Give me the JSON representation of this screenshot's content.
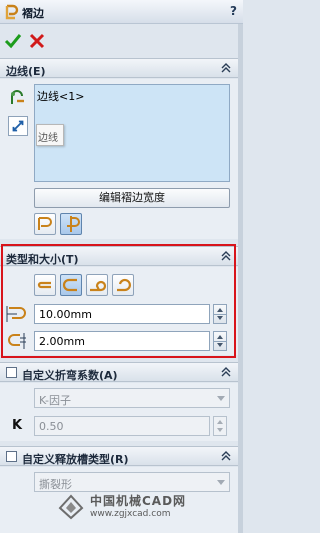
{
  "window": {
    "title": "褶边",
    "help": "?"
  },
  "actions": {
    "ok": "confirm",
    "cancel": "cancel"
  },
  "edges_section": {
    "title": "边线(E)",
    "selected_items": [
      "边线<1>"
    ],
    "tooltip": "边线",
    "edit_button": "编辑褶边宽度"
  },
  "type_size_section": {
    "title": "类型和大小(T)",
    "length_value": "10.00mm",
    "gap_value": "2.00mm"
  },
  "bend_allowance_section": {
    "title": "自定义折弯系数(A)",
    "checked": false,
    "type_value": "K-因子",
    "k_label": "K",
    "k_value": "0.50"
  },
  "relief_section": {
    "title": "自定义释放槽类型(R)",
    "checked": false,
    "type_value": "撕裂形"
  },
  "watermark": {
    "text": "中国机械CAD网",
    "url": "www.zgjxcad.com"
  },
  "colors": {
    "highlight_border": "#d8141b",
    "selection_bg": "#cde4f6"
  }
}
